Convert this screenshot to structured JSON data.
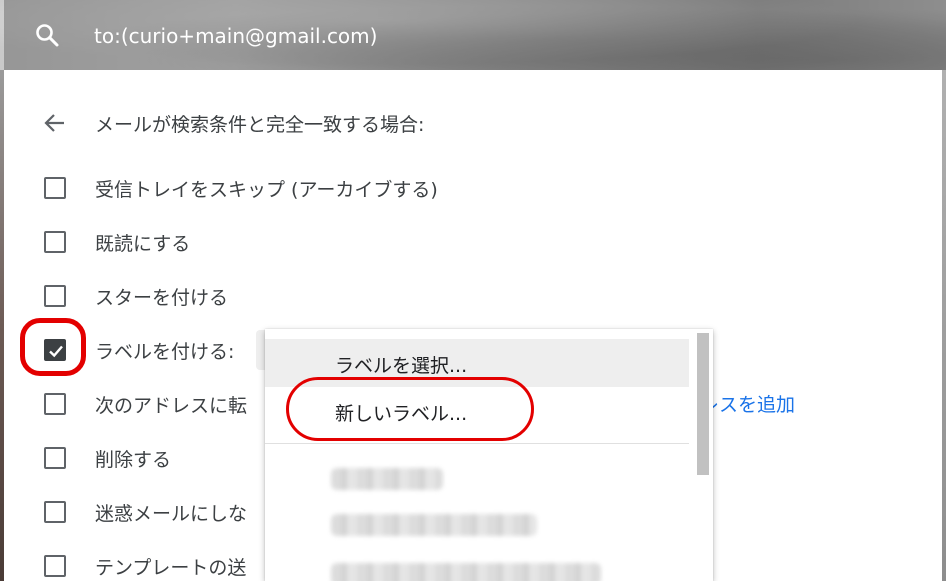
{
  "search": {
    "query": "to:(curio+main@gmail.com)"
  },
  "filter": {
    "header": "メールが検索条件と完全一致する場合:",
    "options": [
      {
        "label": "受信トレイをスキップ (アーカイブする)",
        "checked": false
      },
      {
        "label": "既読にする",
        "checked": false
      },
      {
        "label": "スターを付ける",
        "checked": false
      },
      {
        "label": "ラベルを付ける:",
        "checked": true
      },
      {
        "label": "次のアドレスに転",
        "checked": false
      },
      {
        "label": "削除する",
        "checked": false
      },
      {
        "label": "迷惑メールにしな",
        "checked": false
      },
      {
        "label": "テンプレートの送",
        "checked": false
      }
    ],
    "add_address_link": "レスを追加"
  },
  "label_dropdown": {
    "items": [
      {
        "label": "ラベルを選択..."
      },
      {
        "label": "新しいラベル..."
      }
    ]
  },
  "colors": {
    "accent_link": "#1a73e8",
    "annotation_red": "#e30000",
    "highlight": "#eeeeee"
  },
  "icons": [
    "search-icon",
    "back-arrow-icon",
    "checkmark-icon"
  ]
}
